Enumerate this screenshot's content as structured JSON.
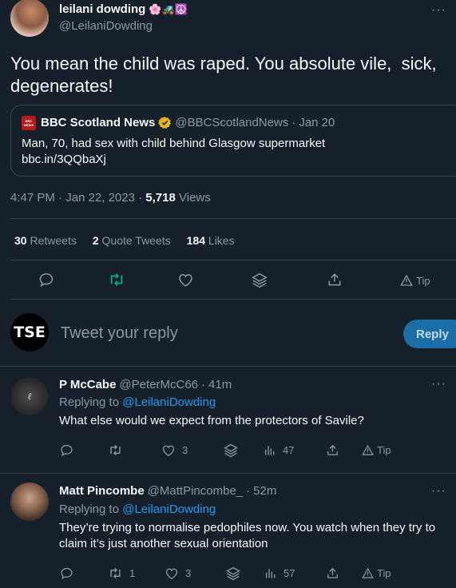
{
  "main_tweet": {
    "author_name": "leilani dowding",
    "author_emoji": "🌸🚜☮️",
    "handle": "@LeilaniDowding",
    "text": "You mean the child was raped. You absolute vile,  sick, degenerates!",
    "quote": {
      "name": "BBC Scotland News",
      "handle": "@BBCScotlandNews",
      "sep": "·",
      "date": "Jan 20",
      "text": "Man, 70, had sex with child behind Glasgow supermarket",
      "link": "bbc.in/3QQbaXj",
      "logo_text": "BBC NEWS"
    },
    "time": "4:47 PM · Jan 22, 2023 ·",
    "views_count": "5,718",
    "views_label": "Views",
    "stats": {
      "retweets_count": "30",
      "retweets_label": "Retweets",
      "quotes_count": "2",
      "quotes_label": "Quote Tweets",
      "likes_count": "184",
      "likes_label": "Likes"
    },
    "tip_label": "Tip"
  },
  "reply_box": {
    "avatar_text": "TSE",
    "placeholder": "Tweet your reply",
    "button_label": "Reply"
  },
  "replies": [
    {
      "name": "P McCabe",
      "handle": "@PeterMcC66",
      "sep": "·",
      "time": "41m",
      "replying_prefix": "Replying to",
      "replying_handle": "@LeilaniDowding",
      "text": "What else would we expect from the protectors of Savile?",
      "reply_count": "",
      "retweet_count": "",
      "like_count": "3",
      "views_count": "47",
      "tip_label": "Tip"
    },
    {
      "name": "Matt Pincombe",
      "handle": "@MattPincombe_",
      "sep": "·",
      "time": "52m",
      "replying_prefix": "Replying to",
      "replying_handle": "@LeilaniDowding",
      "text": "They’re trying to normalise pedophiles now. You watch when they try to claim it’s just another sexual orientation",
      "reply_count": "",
      "retweet_count": "1",
      "like_count": "3",
      "views_count": "57",
      "tip_label": "Tip"
    }
  ],
  "colors": {
    "background": "#15202b",
    "divider": "#38444d",
    "accent": "#1d9bf0",
    "retweet_green": "#00ba7c",
    "muted": "#8b98a5"
  }
}
